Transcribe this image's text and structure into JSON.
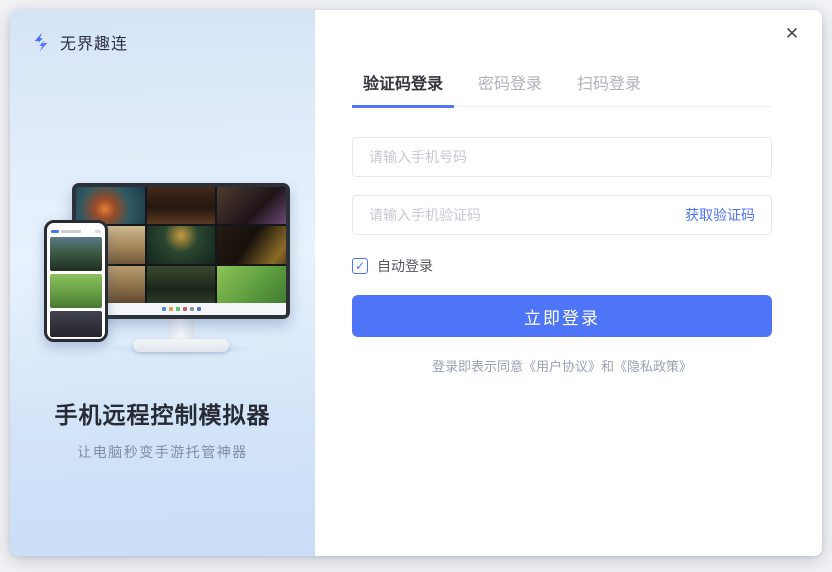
{
  "window": {
    "close_icon": "✕"
  },
  "brand": {
    "name": "无界趣连",
    "logo_icon": "lightning-bolt"
  },
  "left_panel": {
    "title": "手机远程控制模拟器",
    "subtitle": "让电脑秒变手游托管神器"
  },
  "login": {
    "tabs": [
      {
        "label": "验证码登录",
        "active": true
      },
      {
        "label": "密码登录",
        "active": false
      },
      {
        "label": "扫码登录",
        "active": false
      }
    ],
    "phone_input": {
      "value": "",
      "placeholder": "请输入手机号码"
    },
    "code_input": {
      "value": "",
      "placeholder": "请输入手机验证码"
    },
    "get_code_label": "获取验证码",
    "auto_login": {
      "label": "自动登录",
      "checked": true,
      "check_icon": "✓"
    },
    "submit_label": "立即登录",
    "agreement": {
      "prefix": "登录即表示同意",
      "user_agreement": "《用户协议》",
      "conjunction": "和",
      "privacy_policy": "《隐私政策》"
    }
  },
  "colors": {
    "accent": "#4e74f8",
    "brand_blue": "#4a6cf0",
    "panel_gradient_top": "#d5e4f6",
    "panel_gradient_bottom": "#c9ddf7",
    "inactive_tab": "#b0b3ba",
    "agreement_text": "#9aa1b4"
  }
}
